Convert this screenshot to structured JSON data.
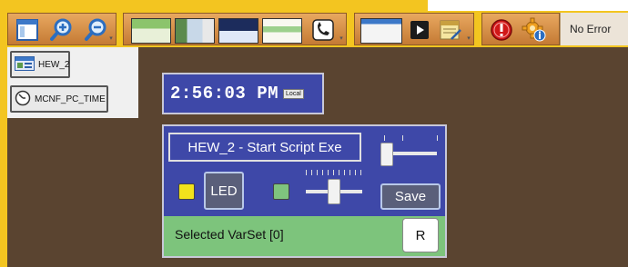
{
  "toolbar": {
    "status_text": "No Error",
    "icons": [
      "window-icon",
      "zoom-in-icon",
      "zoom-out-icon",
      "hmi-thumbnail-icon",
      "image-thumbnail-icon",
      "dashboard-thumbnail-icon",
      "document-thumbnail-icon",
      "phone-icon",
      "screen-thumbnail-icon",
      "play-icon",
      "notepad-icon",
      "error-icon",
      "settings-info-icon"
    ]
  },
  "sidebar": {
    "items": [
      {
        "label": "HEW_2"
      },
      {
        "label": "MCNF_PC_TIME"
      }
    ]
  },
  "clock": {
    "time": "2:56:03 PM",
    "zone_badge": "Local"
  },
  "script_panel": {
    "name": "HEW_2 - Start Script Exe",
    "led_label": "LED",
    "save_label": "Save",
    "varset_label": "Selected VarSet [0]",
    "r_label": "R"
  },
  "colors": {
    "frame_yellow": "#f3c520",
    "panel_blue": "#3e48a8",
    "varset_green": "#7dc47c",
    "led_yellow": "#f2e21c",
    "led_green": "#7fc47e",
    "background_brown": "#5a4430"
  }
}
